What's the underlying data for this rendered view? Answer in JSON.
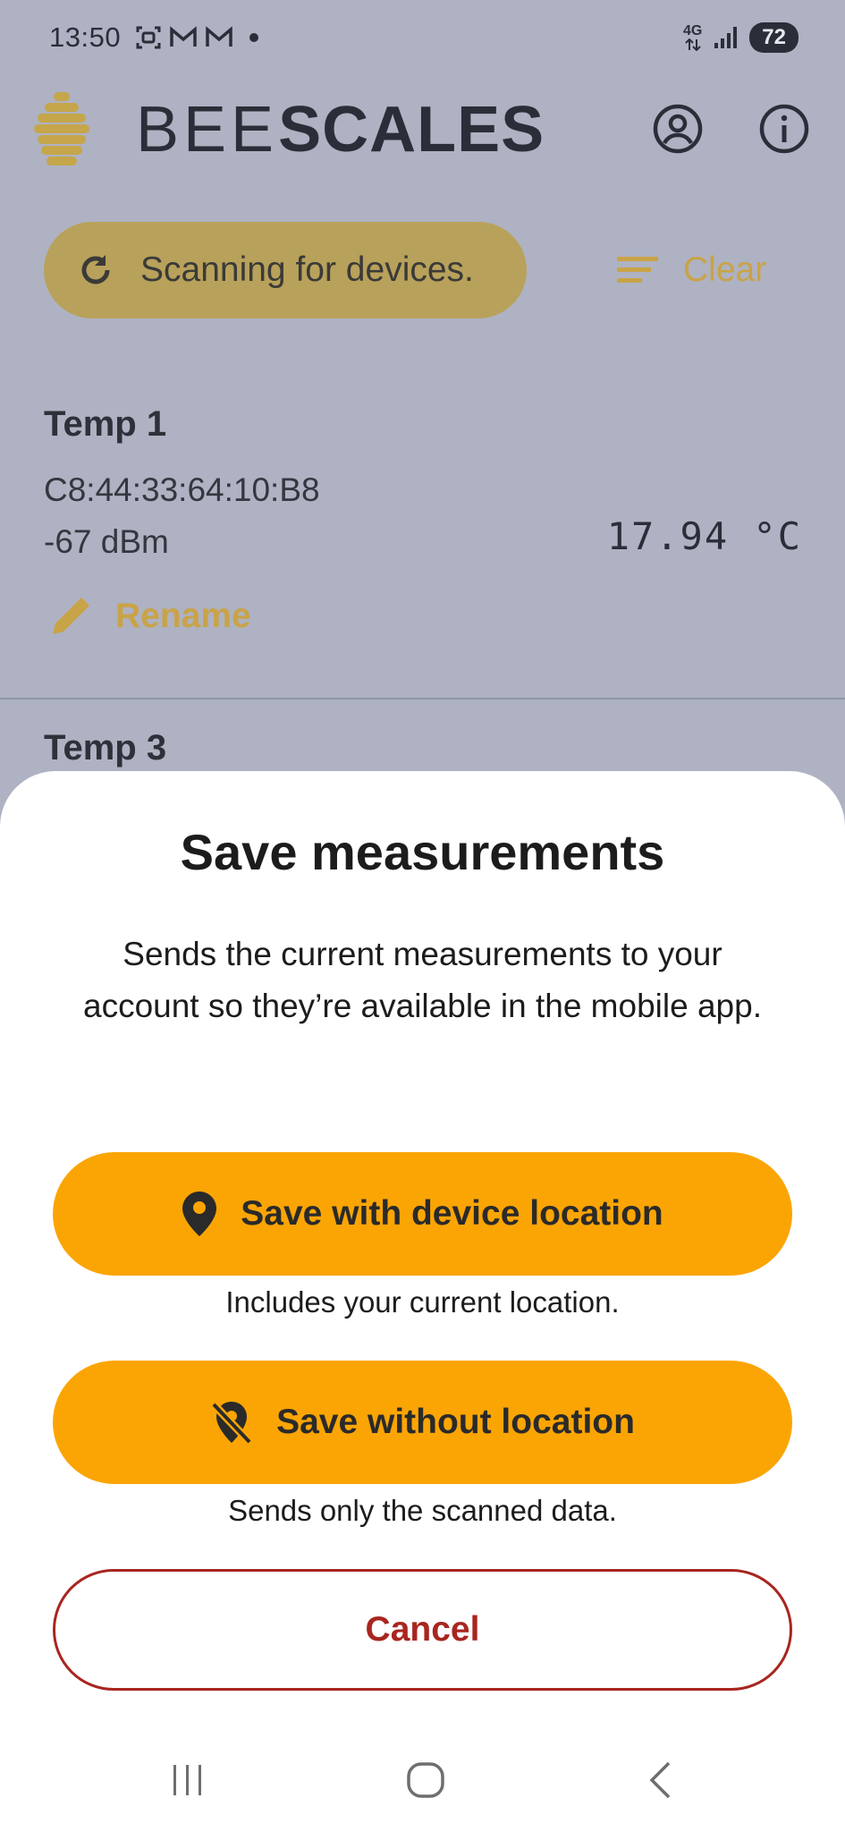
{
  "status_bar": {
    "time": "13:50",
    "network": "4G",
    "battery": "72"
  },
  "header": {
    "logo_thin": "BEE",
    "logo_bold": "SCALES",
    "brand_color": "#c9a347"
  },
  "toolbar": {
    "scan_label": "Scanning for devices.",
    "clear_label": "Clear"
  },
  "devices": [
    {
      "name": "Temp 1",
      "mac": "C8:44:33:64:10:B8",
      "rssi": "-67 dBm",
      "temperature": "17.94 °C",
      "rename_label": "Rename"
    },
    {
      "name": "Temp 3"
    }
  ],
  "sheet": {
    "title": "Save measurements",
    "description": "Sends the current measurements to your account so they’re available in the mobile app.",
    "save_with_location_label": "Save with device location",
    "save_with_location_helper": "Includes your current location.",
    "save_without_location_label": "Save without location",
    "save_without_location_helper": "Sends only the scanned data.",
    "cancel_label": "Cancel",
    "accent_color": "#fba504",
    "cancel_color": "#a8261f"
  }
}
